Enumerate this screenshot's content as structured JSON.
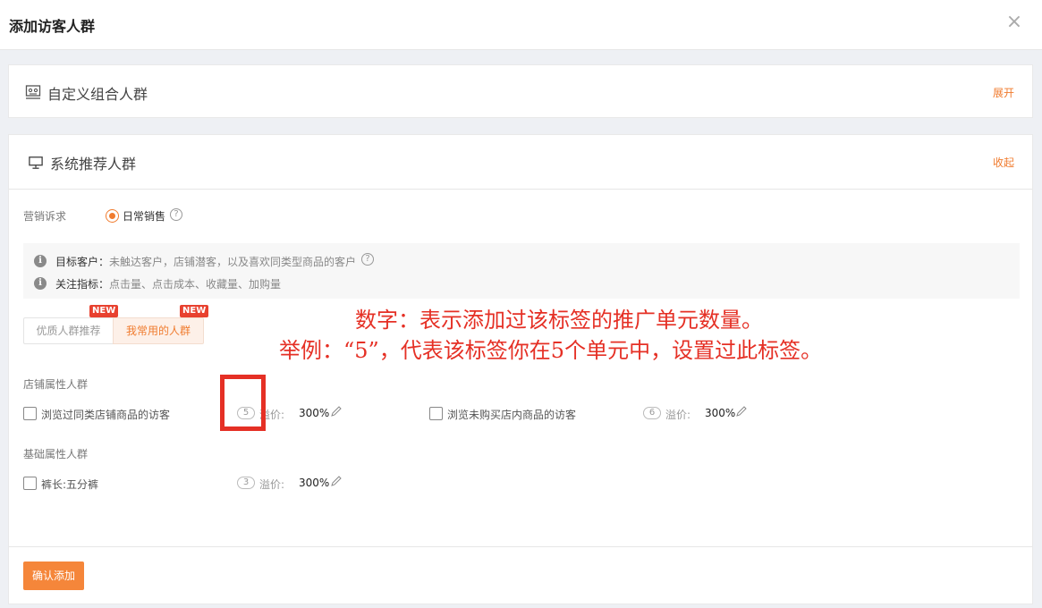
{
  "dialog": {
    "title": "添加访客人群",
    "close_icon": "×"
  },
  "custom_group": {
    "title": "自定义组合人群",
    "icon": "custom-group-icon",
    "action": "展开"
  },
  "recommended_group": {
    "title": "系统推荐人群",
    "icon": "monitor-icon",
    "action": "收起",
    "marketing_label": "营销诉求",
    "marketing_option": "日常销售",
    "help_mark": "?",
    "info": [
      {
        "key": "目标客户：",
        "value": "未触达客户，店铺潜客，以及喜欢同类型商品的客户"
      },
      {
        "key": "关注指标：",
        "value": "点击量、点击成本、收藏量、加购量"
      }
    ],
    "info_icon_glyph": "i",
    "tabs": [
      {
        "label": "优质人群推荐",
        "badge": "NEW"
      },
      {
        "label": "我常用的人群",
        "badge": "NEW"
      }
    ],
    "sections": [
      {
        "title": "店铺属性人群",
        "items": [
          {
            "label": "浏览过同类店铺商品的访客",
            "count": "5",
            "premium_label": "溢价:",
            "premium_value": "300%"
          },
          {
            "label": "浏览未购买店内商品的访客",
            "count": "6",
            "premium_label": "溢价:",
            "premium_value": "300%"
          }
        ]
      },
      {
        "title": "基础属性人群",
        "items": [
          {
            "label": "裤长:五分裤",
            "count": "3",
            "premium_label": "溢价:",
            "premium_value": "300%"
          }
        ]
      }
    ],
    "confirm_button": "确认添加"
  },
  "annotation": {
    "line1": "数字：表示添加过该标签的推广单元数量。",
    "line2": "举例：“5”，代表该标签你在5个单元中，设置过此标签。",
    "color": "#e53025"
  },
  "colors": {
    "accent": "#f07b2e",
    "button": "#f5863a",
    "badge": "#e8412f"
  }
}
